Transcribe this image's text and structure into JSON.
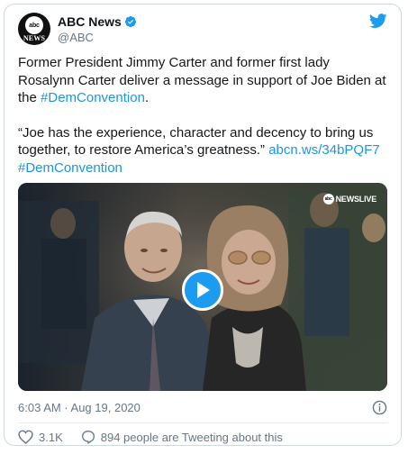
{
  "account": {
    "display_name": "ABC News",
    "handle": "@ABC",
    "avatar_top": "abc",
    "avatar_bottom": "NEWS"
  },
  "tweet": {
    "para1_text": "Former President Jimmy Carter and former first lady Rosalynn Carter deliver a message in support of Joe Biden at the",
    "para1_hashtag": "#DemConvention",
    "para1_end": ".",
    "para2_quote": "“Joe has the experience, character and decency to bring us together, to restore America’s greatness.”",
    "para2_link": "abcn.ws/34bPQF7",
    "para2_hashtag": "#DemConvention"
  },
  "media": {
    "badge": "NEWSLIVE",
    "badge_logo": "abc"
  },
  "meta": {
    "timestamp": "6:03 AM · Aug 19, 2020"
  },
  "actions": {
    "like_count": "3.1K",
    "reply_text": "894 people are Tweeting about this"
  },
  "colors": {
    "link": "#1b95e0",
    "twitter_blue": "#1d9bf0",
    "muted": "#657786"
  },
  "icons": [
    "verified-badge-icon",
    "twitter-bird-icon",
    "play-icon",
    "info-icon",
    "heart-icon",
    "speech-bubble-icon"
  ]
}
